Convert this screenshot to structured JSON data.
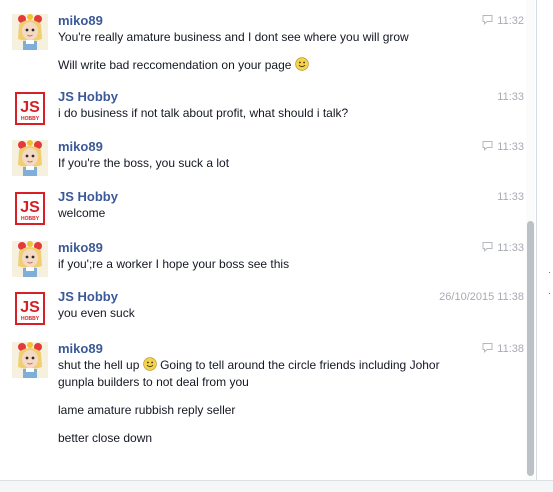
{
  "messages": [
    {
      "sender": "miko89",
      "time": "11:32",
      "lines": [
        "You're really amature business and I dont see where you will grow",
        "Will write bad reccomendation on your page"
      ]
    },
    {
      "sender": "JS Hobby",
      "time": "11:33",
      "lines": [
        "i do business if not talk about profit, what should i talk?"
      ]
    },
    {
      "sender": "miko89",
      "time": "11:33",
      "lines": [
        "If you're the boss, you suck a lot"
      ]
    },
    {
      "sender": "JS Hobby",
      "time": "11:33",
      "lines": [
        "welcome"
      ]
    },
    {
      "sender": "miko89",
      "time": "11:33",
      "lines": [
        "if you';re a worker I hope your boss see this"
      ]
    },
    {
      "sender": "JS Hobby",
      "time": "26/10/2015 11:38",
      "lines": [
        "you even suck"
      ]
    },
    {
      "sender": "miko89",
      "time": "11:38",
      "lines": [
        "shut the hell up",
        "Going to tell around the circle friends including Johor",
        "gunpla builders to not deal from you",
        "lame amature rubbish reply seller",
        "better close down"
      ]
    }
  ],
  "avatars": {
    "js_logo_text": "JS",
    "js_logo_subtext": "HOBBY"
  },
  "colors": {
    "sender_name": "#3b5998",
    "message_text": "#141823",
    "timestamp": "#a7abb2",
    "js_logo_red": "#d71f26"
  },
  "icons": {
    "reply": "reply-icon",
    "smiley": "smiley-icon"
  }
}
